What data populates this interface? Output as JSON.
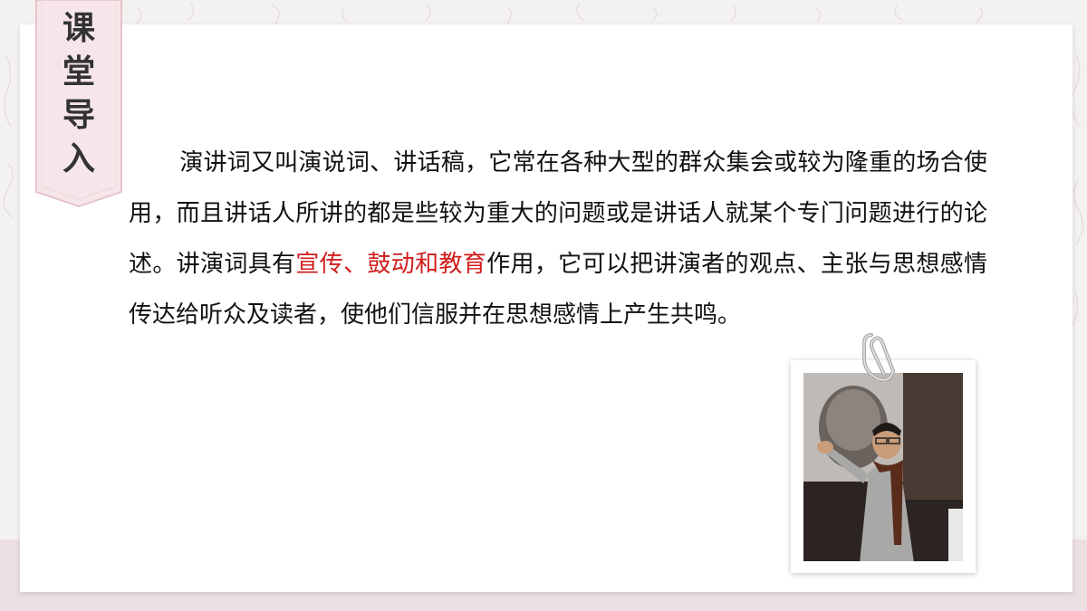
{
  "section_tag": {
    "chars": [
      "课",
      "堂",
      "导",
      "入"
    ]
  },
  "paragraph": {
    "before": "演讲词又叫演说词、讲话稿，它常在各种大型的群众集会或较为隆重的场合使用，而且讲话人所讲的都是些较为重大的问题或是讲话人就某个专门问题进行的论述。讲演词具有",
    "highlight": "宣传、鼓动和教育",
    "after": "作用，它可以把讲演者的观点、主张与思想感情传达给听众及读者，使他们信服并在思想感情上产生共鸣。"
  },
  "photo": {
    "icon": "speaker-photo"
  },
  "colors": {
    "highlight": "#d11c1c",
    "tag_fill": "#f7e6e9",
    "tag_border": "#e5c4cb",
    "bottom_band": "#ecdfe2"
  }
}
